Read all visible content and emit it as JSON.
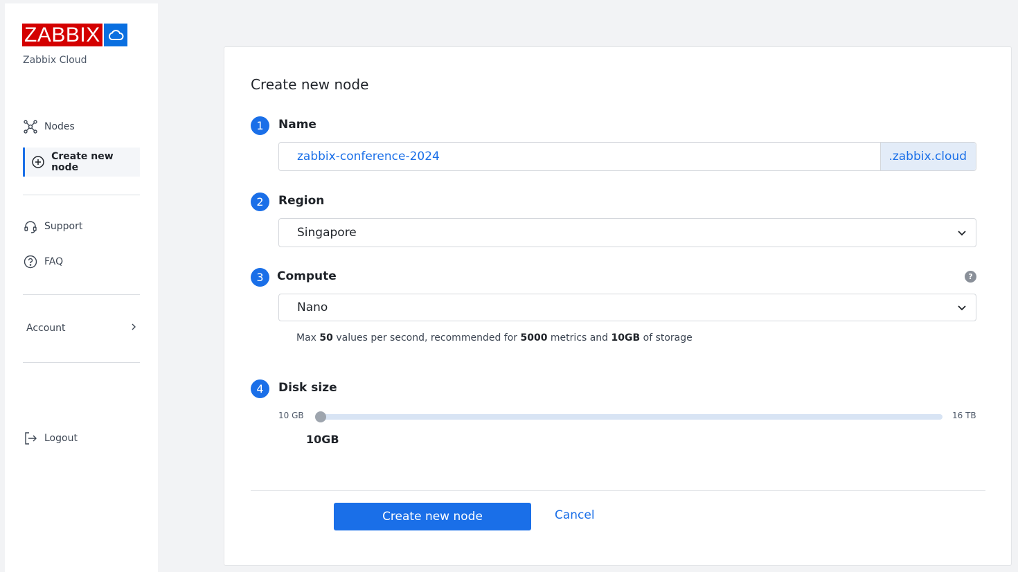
{
  "brand": {
    "logo_text": "ZABBIX",
    "subtitle": "Zabbix Cloud",
    "logo_color": "#d40000",
    "cloud_color": "#0a6fe0"
  },
  "sidebar": {
    "items": [
      {
        "label": "Nodes",
        "icon": "nodes-icon"
      },
      {
        "label": "Create new node",
        "icon": "plus-circle-icon",
        "active": true
      },
      {
        "label": "Support",
        "icon": "headset-icon"
      },
      {
        "label": "FAQ",
        "icon": "question-circle-icon"
      }
    ],
    "account_label": "Account",
    "logout_label": "Logout"
  },
  "form": {
    "title": "Create new node",
    "accent": "#1a6fe8",
    "steps": {
      "name": {
        "number": "1",
        "label": "Name",
        "value": "zabbix-conference-2024",
        "suffix": ".zabbix.cloud"
      },
      "region": {
        "number": "2",
        "label": "Region",
        "value": "Singapore"
      },
      "compute": {
        "number": "3",
        "label": "Compute",
        "value": "Nano",
        "desc_prefix": "Max ",
        "desc_values": "50",
        "desc_mid1": " values per second, recommended for ",
        "desc_metrics": "5000",
        "desc_mid2": " metrics and ",
        "desc_storage": "10GB",
        "desc_suffix": " of storage"
      },
      "disk": {
        "number": "4",
        "label": "Disk size",
        "min_label": "10 GB",
        "max_label": "16 TB",
        "value_label": "10GB",
        "fraction": 0
      }
    },
    "submit_label": "Create new node",
    "cancel_label": "Cancel"
  }
}
